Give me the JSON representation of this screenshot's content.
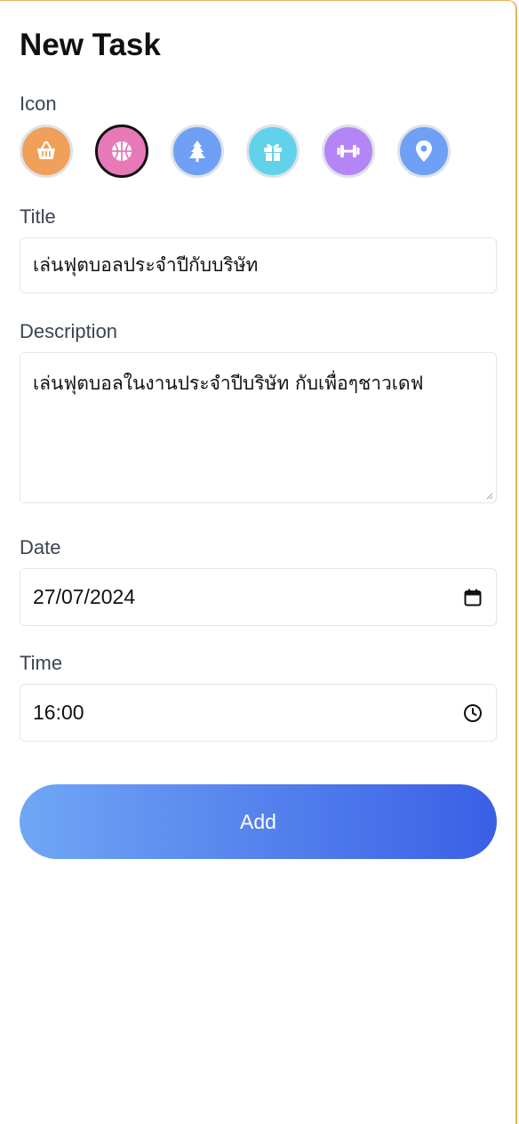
{
  "page": {
    "title": "New Task"
  },
  "icon_picker": {
    "label": "Icon",
    "options": [
      {
        "icon": "basket-icon",
        "color": "#f0a058",
        "selected": false
      },
      {
        "icon": "basketball-icon",
        "color": "#e879b9",
        "selected": true
      },
      {
        "icon": "tree-icon",
        "color": "#6fa0f5",
        "selected": false
      },
      {
        "icon": "gift-icon",
        "color": "#62d2ea",
        "selected": false
      },
      {
        "icon": "dumbbell-icon",
        "color": "#b486f5",
        "selected": false
      },
      {
        "icon": "location-pin-icon",
        "color": "#6fa0f5",
        "selected": false
      }
    ]
  },
  "form": {
    "title_label": "Title",
    "title_value": "เล่นฟุตบอลประจำปีกับบริษัท",
    "description_label": "Description",
    "description_value": "เล่นฟุตบอลในงานประจำปีบริษัท กับเพื่อๆชาวเดฟ",
    "date_label": "Date",
    "date_value": "27/07/2024",
    "time_label": "Time",
    "time_value": "16:00"
  },
  "actions": {
    "add_label": "Add"
  },
  "colors": {
    "frame_border": "#e8b35f",
    "button_gradient_start": "#71a6f5",
    "button_gradient_end": "#3a5fe6"
  }
}
